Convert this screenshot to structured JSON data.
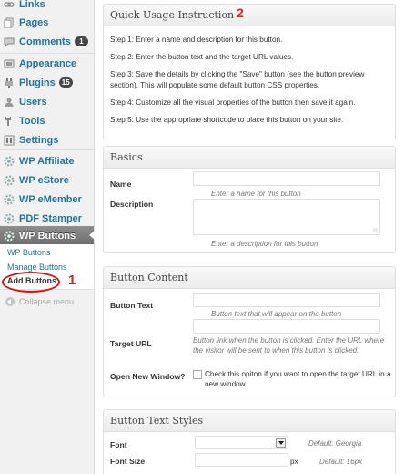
{
  "sidebar": {
    "items": [
      {
        "id": "links",
        "label": "Links",
        "icon": "links-icon"
      },
      {
        "id": "pages",
        "label": "Pages",
        "icon": "pages-icon"
      },
      {
        "id": "comments",
        "label": "Comments",
        "icon": "comments-icon",
        "badge": "1"
      },
      {
        "id": "appearance",
        "label": "Appearance",
        "icon": "appearance-icon"
      },
      {
        "id": "plugins",
        "label": "Plugins",
        "icon": "plugins-icon",
        "badge": "15"
      },
      {
        "id": "users",
        "label": "Users",
        "icon": "users-icon"
      },
      {
        "id": "tools",
        "label": "Tools",
        "icon": "tools-icon"
      },
      {
        "id": "settings",
        "label": "Settings",
        "icon": "settings-icon"
      },
      {
        "id": "wp-affiliate",
        "label": "WP Affiliate",
        "icon": "plugin-gear-icon"
      },
      {
        "id": "wp-estore",
        "label": "WP eStore",
        "icon": "plugin-gear-icon"
      },
      {
        "id": "wp-emember",
        "label": "WP eMember",
        "icon": "plugin-gear-icon"
      },
      {
        "id": "pdf-stamper",
        "label": "PDF Stamper",
        "icon": "plugin-gear-icon"
      },
      {
        "id": "wp-buttons",
        "label": "WP Buttons",
        "icon": "plugin-gear-icon",
        "active": true
      }
    ],
    "submenu": [
      "WP Buttons",
      "Manage Buttons",
      "Add Buttons"
    ],
    "collapse_label": "Collapse menu"
  },
  "annotations": {
    "marker_1": "1",
    "marker_2": "2"
  },
  "quick_usage": {
    "title": "Quick Usage Instruction",
    "steps": [
      "Step 1: Enter a name and description for this button.",
      "Step 2: Enter the button text and the target URL values.",
      "Step 3: Save the details by clicking the \"Save\" button (see the button preview section). This will populate some default button CSS properties.",
      "Step 4: Customize all the visual properties of the button then save it again.",
      "Step 5: Use the appropriate shortcode to place this button on your site."
    ]
  },
  "basics": {
    "title": "Basics",
    "name_label": "Name",
    "name_hint": "Enter a name for this button",
    "description_label": "Description",
    "description_hint": "Enter a description for this button"
  },
  "button_content": {
    "title": "Button Content",
    "text_label": "Button Text",
    "text_hint": "Button text that will appear on the button",
    "url_label": "Target URL",
    "url_hint": "Button link when the button is clicked. Enter the URL where the visitor will be sent to when this button is clicked.",
    "new_window_label": "Open New Window?",
    "new_window_text": "Check this opiton if you want to open the target URL in a new window"
  },
  "text_styles": {
    "title": "Button Text Styles",
    "font_label": "Font",
    "font_default": "Default: Georgia",
    "size_label": "Font Size",
    "size_unit": "px",
    "size_default": "Default: 16px"
  },
  "colors": {
    "link": "#21759b",
    "annotation": "#d42121",
    "active_menu": "#7e7e7e"
  }
}
